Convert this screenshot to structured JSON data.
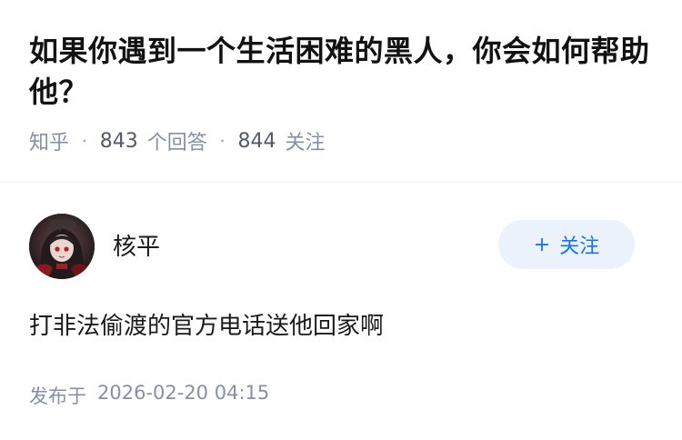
{
  "question": {
    "title": "如果你遇到一个生活困难的黑人，你会如何帮助他？",
    "source": "知乎",
    "separator": "·",
    "answer_count": "843",
    "answer_count_label": "个回答",
    "follower_count": "844",
    "follower_count_label": "关注"
  },
  "answer": {
    "author": {
      "name": "核平",
      "avatar_icon": "anime-character-avatar"
    },
    "follow_button": {
      "icon": "+",
      "label": "关注",
      "color": "#1772f6",
      "background": "#ebf2fb"
    },
    "content": "打非法偷渡的官方电话送他回家啊",
    "publish_label": "发布于",
    "publish_time": "2026-02-20 04:15"
  }
}
